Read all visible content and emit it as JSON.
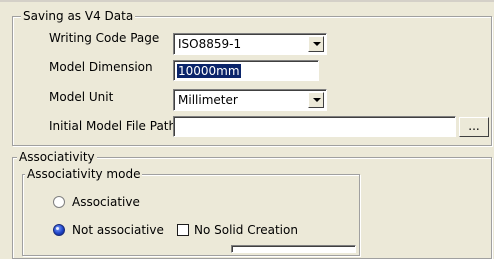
{
  "saving_group": {
    "title": "Saving as V4 Data",
    "writing_code_page": {
      "label": "Writing Code Page",
      "value": "ISO8859-1"
    },
    "model_dimension": {
      "label": "Model Dimension",
      "value": "10000mm"
    },
    "model_unit": {
      "label": "Model Unit",
      "value": "Millimeter"
    },
    "initial_model_file_path": {
      "label": "Initial Model File Path",
      "value": "",
      "browse_label": "..."
    }
  },
  "associativity_group": {
    "title": "Associativity",
    "mode_group": {
      "title": "Associativity mode",
      "options": [
        {
          "label": "Associative",
          "selected": false
        },
        {
          "label": "Not associative",
          "selected": true
        }
      ],
      "no_solid_creation": {
        "label": "No Solid Creation",
        "checked": false
      }
    }
  },
  "colors": {
    "background": "#ece9d8",
    "selection": "#0a246a"
  }
}
